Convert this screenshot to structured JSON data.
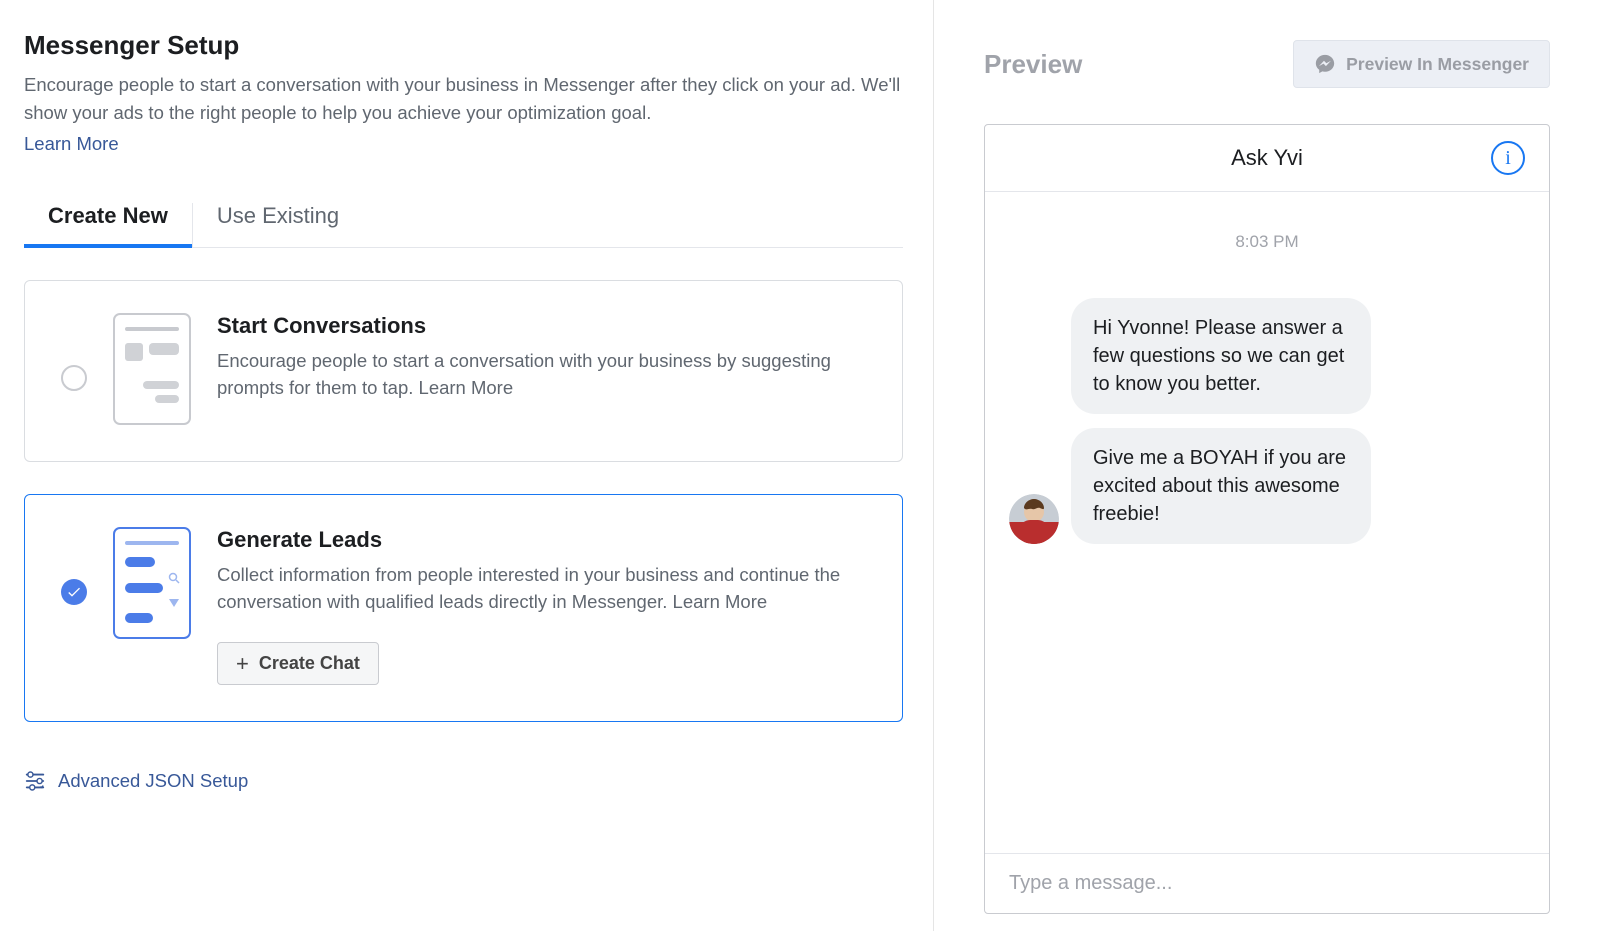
{
  "header": {
    "title": "Messenger Setup",
    "description": "Encourage people to start a conversation with your business in Messenger after they click on your ad. We'll show your ads to the right people to help you achieve your optimization goal.",
    "learn_more": "Learn More"
  },
  "tabs": {
    "create_new": "Create New",
    "use_existing": "Use Existing"
  },
  "options": {
    "start_conversations": {
      "title": "Start Conversations",
      "description": "Encourage people to start a conversation with your business by suggesting prompts for them to tap. ",
      "learn_more": "Learn More"
    },
    "generate_leads": {
      "title": "Generate Leads",
      "description": "Collect information from people interested in your business and continue the conversation with qualified leads directly in Messenger. ",
      "learn_more": "Learn More",
      "create_chat_label": "Create Chat"
    }
  },
  "advanced_json_label": "Advanced JSON Setup",
  "preview": {
    "heading": "Preview",
    "button_label": "Preview In Messenger",
    "chat_title": "Ask Yvi",
    "timestamp": "8:03 PM",
    "messages": [
      "Hi Yvonne! Please answer a few questions so we can get to know you better.",
      "Give me a BOYAH if you are excited about this awesome freebie!"
    ],
    "input_placeholder": "Type a message..."
  }
}
